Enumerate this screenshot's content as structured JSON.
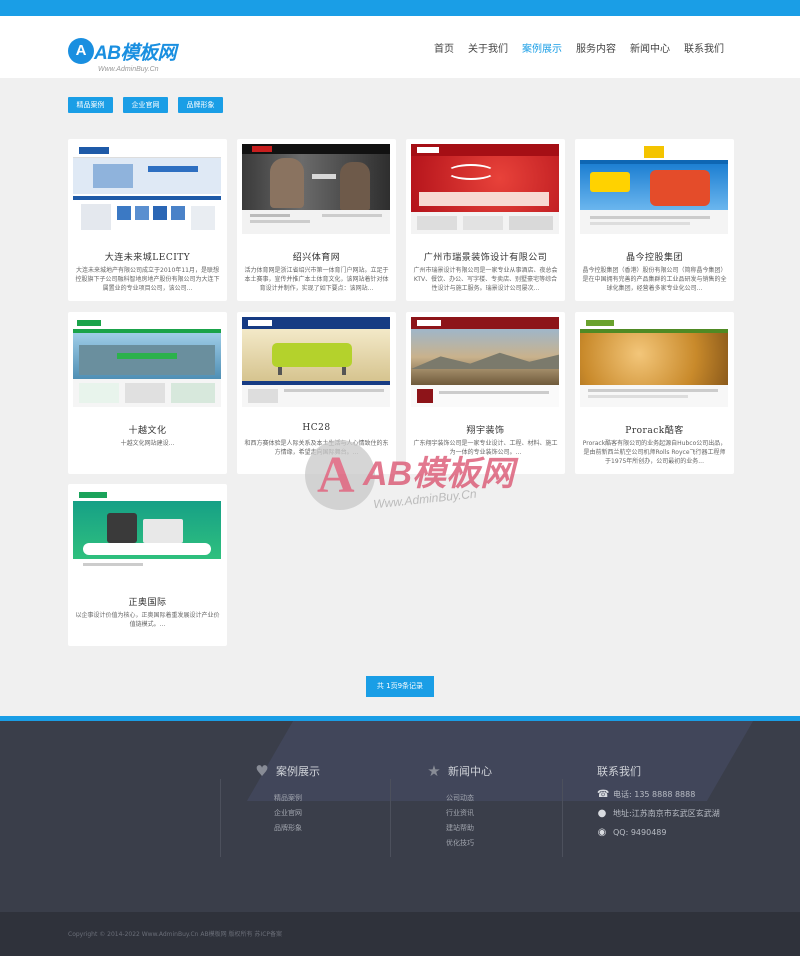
{
  "brand": {
    "logo_letter": "A",
    "logo_text": "AB模板网",
    "logo_sub": "Www.AdminBuy.Cn"
  },
  "nav": [
    {
      "label": "首页"
    },
    {
      "label": "关于我们"
    },
    {
      "label": "案例展示",
      "active": true
    },
    {
      "label": "服务内容"
    },
    {
      "label": "新闻中心"
    },
    {
      "label": "联系我们"
    }
  ],
  "filters": [
    "精品案例",
    "企业官网",
    "品牌形象"
  ],
  "cases": [
    {
      "title": "大连未来城LECITY",
      "desc": "大连未来城地产有限公司成立于2010年11月，是联想控股旗下子公司融科智地房地产股份有限公司为大连下属置业的专业项目公司，该公司..."
    },
    {
      "title": "绍兴体育网",
      "desc": "活力体育网是浙江省绍兴市第一体育门户网站。立足于本土赛事，宣传并推广本土体育文化，该网站着针对体育设计并制作，实现了如下要点：该网站..."
    },
    {
      "title": "广州市瑞景装饰设计有限公司",
      "desc": "广州市瑞景设计有限公司是一家专业从事酒店、夜总会KTV、餐饮、办公、写字楼、专卖店、别墅豪宅等综合性设计与施工服务。瑞景设计公司屡次..."
    },
    {
      "title": "晶今控股集团",
      "desc": "晶今控股集团（香港）股份有限公司（简称晶今集团）是在中国拥有完善的产品集群的工业品研发与销售的全球化集团，经营着多家专业化公司..."
    },
    {
      "title": "十越文化",
      "desc": "十越文化网站建设..."
    },
    {
      "title": "HC28",
      "desc": "和西方赛体验是人际关系及本土生活与人心情致住的东方情缘，希望走向国际舞台。..."
    },
    {
      "title": "翔宇装饰",
      "desc": "广东翔宇装饰公司是一家专业设计、工程、材料、施工为一体的专业装饰公司。..."
    },
    {
      "title": "Prorack酷客",
      "desc": "Prorack酷客有限公司的业务起源自Hubco公司出品，是由前新西兰航空公司机师Rolls Royce飞行器工程师于1975年所创办，公司最初的业务..."
    },
    {
      "title": "正奥国际",
      "desc": "以企事设计价值为核心，正奥国际着重发展设计产业价值链模式。..."
    }
  ],
  "pager": "共 1页9条记录",
  "watermark": {
    "letter": "A",
    "text": "AB模板网",
    "sub": "Www.AdminBuy.Cn"
  },
  "footer": {
    "col1": {
      "title": "案例展示",
      "items": [
        "精品案例",
        "企业官网",
        "品牌形象"
      ]
    },
    "col2": {
      "title": "新闻中心",
      "items": [
        "公司动态",
        "行业资讯",
        "建站帮助",
        "优化技巧"
      ]
    },
    "col3": {
      "title": "联系我们",
      "phone": "电话: 135 8888 8888",
      "address": "地址:江苏南京市玄武区玄武湖",
      "qq": "QQ: 9490489"
    },
    "copyright": "Copyright © 2014-2022 Www.AdminBuy.Cn AB模板网 版权所有  苏ICP备案"
  },
  "colors": {
    "accent": "#1a9ee6",
    "footer_bg": "#3a3e4a",
    "copyright_bg": "#2f323b"
  }
}
